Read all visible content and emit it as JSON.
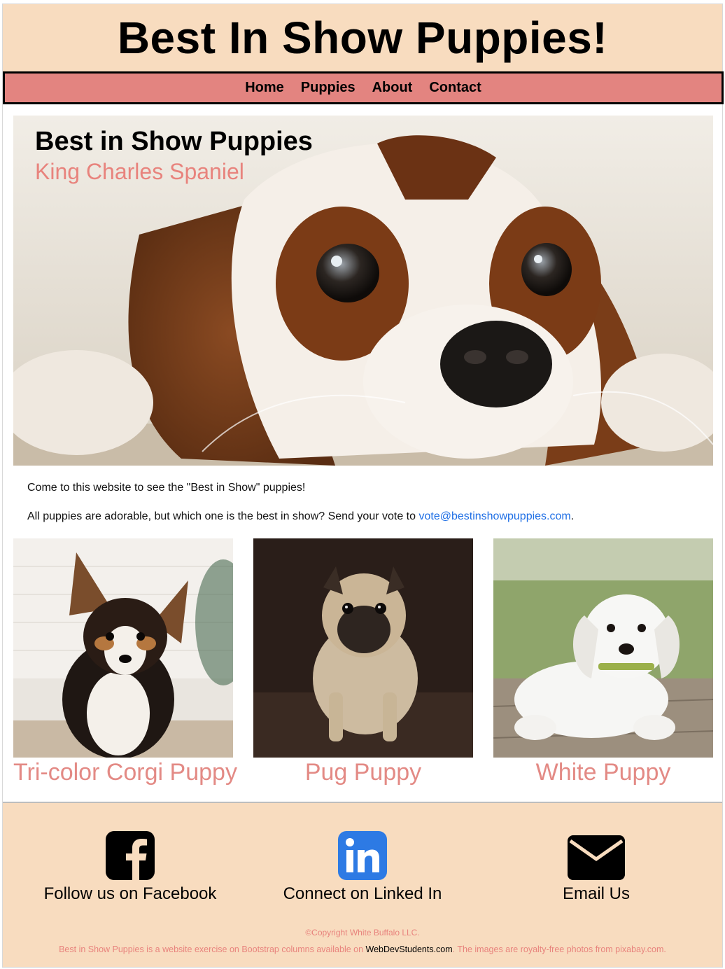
{
  "header": {
    "title": "Best In Show Puppies!"
  },
  "nav": {
    "items": [
      {
        "label": "Home"
      },
      {
        "label": "Puppies"
      },
      {
        "label": "About"
      },
      {
        "label": "Contact"
      }
    ]
  },
  "hero": {
    "heading": "Best in Show Puppies",
    "subheading": "King Charles Spaniel",
    "image": "king-charles-spaniel-photo"
  },
  "intro": {
    "line1": "Come to this website to see the \"Best in Show\" puppies!",
    "line2_prefix": "All puppies are adorable, but which one is the best in show? Send your vote to ",
    "email": "vote@bestinshowpuppies.com",
    "line2_suffix": "."
  },
  "puppies": [
    {
      "label": "Tri-color Corgi Puppy",
      "image": "corgi-puppy-photo"
    },
    {
      "label": "Pug Puppy",
      "image": "pug-puppy-photo"
    },
    {
      "label": "White Puppy",
      "image": "white-puppy-photo"
    }
  ],
  "footer": {
    "social": [
      {
        "label": "Follow us on Facebook",
        "icon": "facebook-icon"
      },
      {
        "label": "Connect on Linked In",
        "icon": "linkedin-icon"
      },
      {
        "label": "Email Us",
        "icon": "email-icon"
      }
    ],
    "copyright": "©Copyright White Buffalo LLC.",
    "note_prefix": "Best in Show Puppies is a website exercise on Bootstrap columns available on ",
    "note_link": "WebDevStudents.com",
    "note_suffix": ". The images are royalty-free photos from pixabay.com."
  },
  "colors": {
    "header_bg": "#f8dcbf",
    "nav_bg": "#e38480",
    "accent_text": "#e8837d",
    "link": "#1f6fe5",
    "linkedin": "#2d7ae4"
  }
}
